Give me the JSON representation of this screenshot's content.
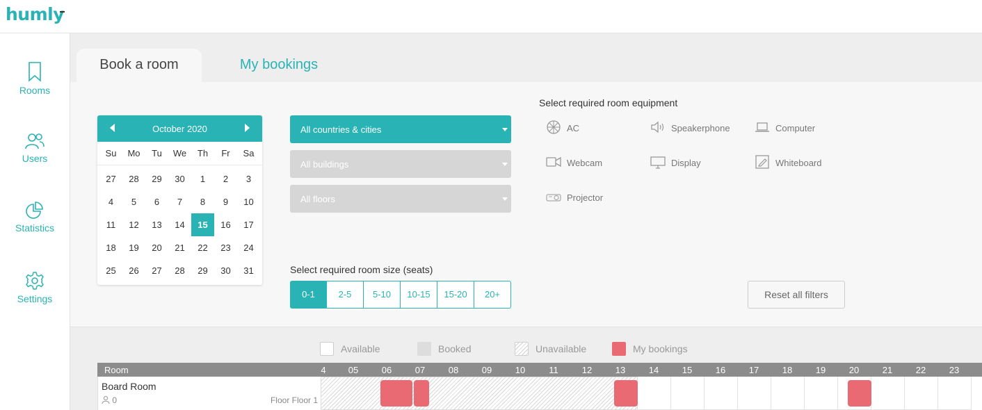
{
  "app": {
    "logo": "humly"
  },
  "sidebar": {
    "items": [
      {
        "label": "Rooms",
        "icon": "bookmark-icon"
      },
      {
        "label": "Users",
        "icon": "users-icon"
      },
      {
        "label": "Statistics",
        "icon": "pie-chart-icon"
      },
      {
        "label": "Settings",
        "icon": "gear-icon"
      }
    ]
  },
  "tabs": {
    "book": "Book a room",
    "mine": "My bookings"
  },
  "calendar": {
    "month": "October 2020",
    "dows": [
      "Su",
      "Mo",
      "Tu",
      "We",
      "Th",
      "Fr",
      "Sa"
    ],
    "weeks": [
      [
        "27",
        "28",
        "29",
        "30",
        "1",
        "2",
        "3"
      ],
      [
        "4",
        "5",
        "6",
        "7",
        "8",
        "9",
        "10"
      ],
      [
        "11",
        "12",
        "13",
        "14",
        "15",
        "16",
        "17"
      ],
      [
        "18",
        "19",
        "20",
        "21",
        "22",
        "23",
        "24"
      ],
      [
        "25",
        "26",
        "27",
        "28",
        "29",
        "30",
        "31"
      ]
    ],
    "selected": "15"
  },
  "filters": {
    "location": "All countries & cities",
    "buildings": "All buildings",
    "floors": "All floors",
    "size_label": "Select required room size (seats)",
    "sizes": [
      "0-1",
      "2-5",
      "5-10",
      "10-15",
      "15-20",
      "20+"
    ],
    "selected_size": "0-1",
    "reset": "Reset all filters"
  },
  "equipment": {
    "title": "Select required room equipment",
    "items": [
      {
        "label": "AC",
        "icon": "ac-icon"
      },
      {
        "label": "Speakerphone",
        "icon": "speaker-icon"
      },
      {
        "label": "Computer",
        "icon": "laptop-icon"
      },
      {
        "label": "Webcam",
        "icon": "webcam-icon"
      },
      {
        "label": "Display",
        "icon": "display-icon"
      },
      {
        "label": "Whiteboard",
        "icon": "whiteboard-icon"
      },
      {
        "label": "Projector",
        "icon": "projector-icon"
      }
    ]
  },
  "legend": {
    "available": "Available",
    "booked": "Booked",
    "unavailable": "Unavailable",
    "my_bookings": "My bookings"
  },
  "colors": {
    "accent": "#29b3b5",
    "my_booking": "#ea6a73",
    "booked": "#dddddd"
  },
  "timeline": {
    "room_header": "Room",
    "hours": [
      "4",
      "05",
      "06",
      "07",
      "08",
      "09",
      "10",
      "11",
      "12",
      "13",
      "14",
      "15",
      "16",
      "17",
      "18",
      "19",
      "20",
      "21",
      "22",
      "23"
    ],
    "rooms": [
      {
        "name": "Board Room",
        "capacity": "0",
        "floor": "Floor Floor 1"
      }
    ],
    "unavailable_span": {
      "from_hour": 4,
      "to_hour": 13.5
    },
    "my_bookings": [
      {
        "from_hour": 5.75,
        "to_hour": 6.75
      },
      {
        "from_hour": 6.75,
        "to_hour": 7.25
      },
      {
        "from_hour": 12.75,
        "to_hour": 13.5
      },
      {
        "from_hour": 19.75,
        "to_hour": 20.5
      }
    ]
  }
}
